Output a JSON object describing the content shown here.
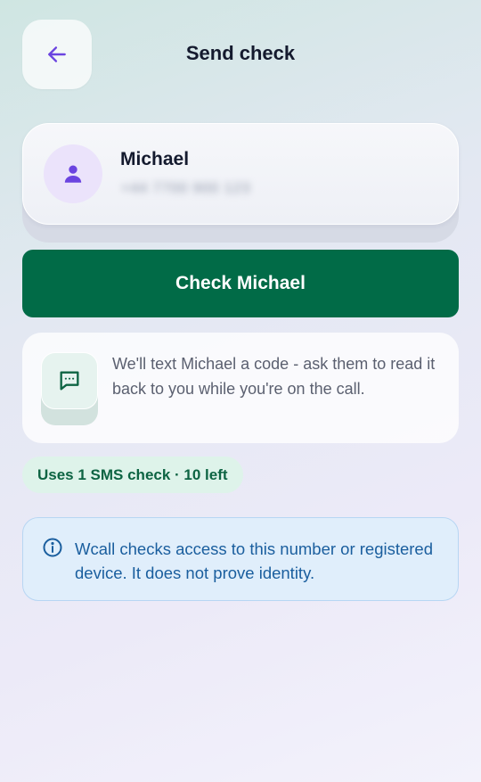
{
  "header": {
    "title": "Send check",
    "back_icon": "arrow-left-icon",
    "back_color": "#6b44e0"
  },
  "contact": {
    "name": "Michael",
    "phone": "+44 7700 900 123",
    "phone_blurred": true,
    "avatar_icon": "person-icon",
    "avatar_color": "#6b44e0"
  },
  "primary_action": {
    "label": "Check Michael",
    "color": "#016b47"
  },
  "info": {
    "icon": "message-dots-icon",
    "text": "We'll text Michael a code - ask them to read it back to you while you're on the call."
  },
  "sms_badge": {
    "text": "Uses 1 SMS check · 10 left"
  },
  "notice": {
    "icon": "info-circle-icon",
    "text": "Wcall checks access to this number or registered device. It does not prove identity."
  }
}
